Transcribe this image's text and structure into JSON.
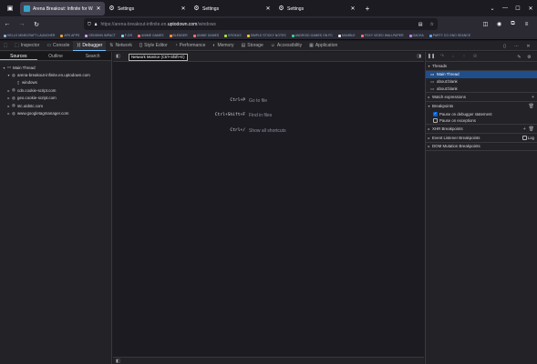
{
  "tabs": [
    {
      "title": "Arena Breakout: Infinite for Wi...",
      "active": true,
      "icon": "uptodown-logo-icon"
    },
    {
      "title": "Settings",
      "active": false,
      "icon": "gear-icon"
    },
    {
      "title": "Settings",
      "active": false,
      "icon": "gear-icon"
    },
    {
      "title": "Settings",
      "active": false,
      "icon": "gear-icon"
    }
  ],
  "url": {
    "prefix": "https://arena-breakout-infinite.en.",
    "domain": "uptodown.com",
    "suffix": "/windows"
  },
  "bookmarks": [
    {
      "label": "HELLO MINECRAFT LAUNCHER",
      "color": "#8fb4d9"
    },
    {
      "label": "APK APPS",
      "color": "#e7a13c"
    },
    {
      "label": "GENSHIN IMPACT",
      "color": "#c9a3ff"
    },
    {
      "label": "F-DR",
      "color": "#7dd3fc"
    },
    {
      "label": "ANIME GAMES",
      "color": "#f87171"
    },
    {
      "label": "BLENDER",
      "color": "#fb923c"
    },
    {
      "label": "ANIME GAMES",
      "color": "#f87171"
    },
    {
      "label": "KROKUS",
      "color": "#a3e635"
    },
    {
      "label": "SIMPLE STICKY NOTES",
      "color": "#facc15"
    },
    {
      "label": "ANDROID GAMES ON PC",
      "color": "#34d399"
    },
    {
      "label": "MUMBLE",
      "color": "#e5e7eb"
    },
    {
      "label": "FOXY VIDEO WALLPAPER",
      "color": "#fb7185"
    },
    {
      "label": "GACHA",
      "color": "#c084fc"
    },
    {
      "label": "PARTY CO GNO SEANCE",
      "color": "#60a5fa"
    }
  ],
  "devtools": {
    "tabs": [
      {
        "label": "Inspector",
        "icon": "inspector-icon",
        "selected": false
      },
      {
        "label": "Console",
        "icon": "console-icon",
        "selected": false
      },
      {
        "label": "Debugger",
        "icon": "debugger-icon",
        "selected": true
      },
      {
        "label": "Network",
        "icon": "network-icon",
        "selected": false
      },
      {
        "label": "Style Editor",
        "icon": "style-editor-icon",
        "selected": false
      },
      {
        "label": "Performance",
        "icon": "performance-icon",
        "selected": false
      },
      {
        "label": "Memory",
        "icon": "memory-icon",
        "selected": false
      },
      {
        "label": "Storage",
        "icon": "storage-icon",
        "selected": false
      },
      {
        "label": "Accessibility",
        "icon": "accessibility-icon",
        "selected": false
      },
      {
        "label": "Application",
        "icon": "application-icon",
        "selected": false
      }
    ],
    "tooltip": "Network Monitor (Ctrl+Shift+E)"
  },
  "sources": {
    "tabs": [
      "Sources",
      "Outline",
      "Search"
    ],
    "tree": [
      {
        "label": "Main Thread",
        "depth": 0,
        "twisty": "▾",
        "icon": "window-icon"
      },
      {
        "label": "arena-breakout-infinite.en.uptodown.com",
        "depth": 1,
        "twisty": "▾",
        "icon": "globe-icon"
      },
      {
        "label": "windows",
        "depth": 2,
        "twisty": "",
        "icon": "file-icon"
      },
      {
        "label": "cdn.cookie-script.com",
        "depth": 1,
        "twisty": "▸",
        "icon": "globe-icon"
      },
      {
        "label": "geo.cookie-script.com",
        "depth": 1,
        "twisty": "▸",
        "icon": "globe-icon"
      },
      {
        "label": "stc.utdstc.com",
        "depth": 1,
        "twisty": "▸",
        "icon": "globe-icon"
      },
      {
        "label": "www.googletagmanager.com",
        "depth": 1,
        "twisty": "▸",
        "icon": "globe-icon"
      }
    ]
  },
  "shortcuts": [
    {
      "key": "Ctrl+P",
      "desc": "Go to file"
    },
    {
      "key": "Ctrl+Shift+F",
      "desc": "Find in files"
    },
    {
      "key": "Ctrl+/",
      "desc": "Show all shortcuts"
    }
  ],
  "right": {
    "threads_label": "Threads",
    "threads": [
      "Main Thread",
      "about:blank",
      "about:blank"
    ],
    "watch_label": "Watch expressions",
    "breakpoints_label": "Breakpoints",
    "pause_debugger": "Pause on debugger statement",
    "pause_exceptions": "Pause on exceptions",
    "xhr_label": "XHR Breakpoints",
    "event_label": "Event Listener Breakpoints",
    "log_label": "Log",
    "dom_label": "DOM Mutation Breakpoints"
  }
}
